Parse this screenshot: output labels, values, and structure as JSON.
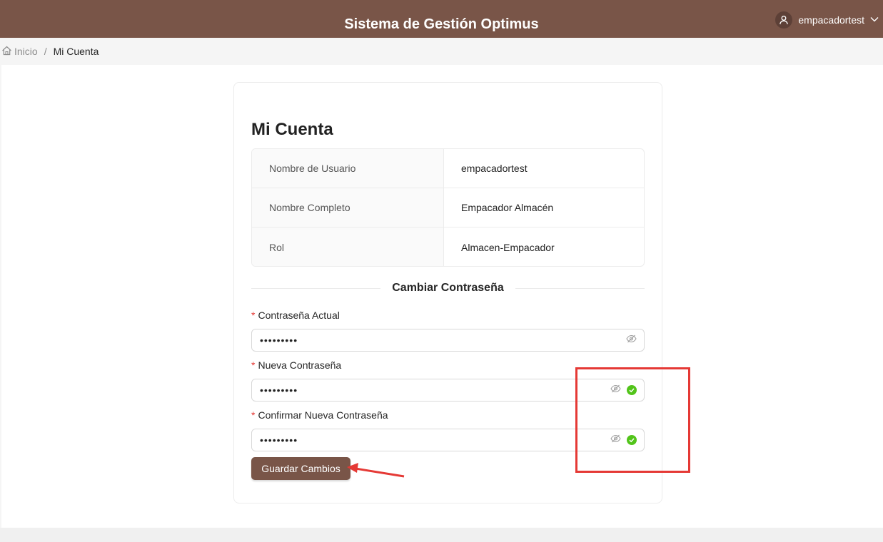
{
  "header": {
    "title": "Sistema de Gestión Optimus",
    "username": "empacadortest",
    "user_icon": "user-icon",
    "menu_icon": "chevron-down-icon"
  },
  "breadcrumb": {
    "home_label": "Inicio",
    "home_icon": "home-icon",
    "separator": "/",
    "current": "Mi Cuenta"
  },
  "account": {
    "title": "Mi Cuenta",
    "rows": [
      {
        "label": "Nombre de Usuario",
        "value": "empacadortest"
      },
      {
        "label": "Nombre Completo",
        "value": "Empacador Almacén"
      },
      {
        "label": "Rol",
        "value": "Almacen-Empacador"
      }
    ]
  },
  "password_form": {
    "section_title": "Cambiar Contraseña",
    "required_mark": "*",
    "fields": [
      {
        "label": "Contraseña Actual",
        "value": "•••••••••",
        "validated": false
      },
      {
        "label": "Nueva Contraseña",
        "value": "•••••••••",
        "validated": true
      },
      {
        "label": "Confirmar Nueva Contraseña",
        "value": "•••••••••",
        "validated": true
      }
    ],
    "submit_label": "Guardar Cambios"
  },
  "colors": {
    "brand": "#795548",
    "success": "#52c41a",
    "annotation": "#e53935"
  }
}
